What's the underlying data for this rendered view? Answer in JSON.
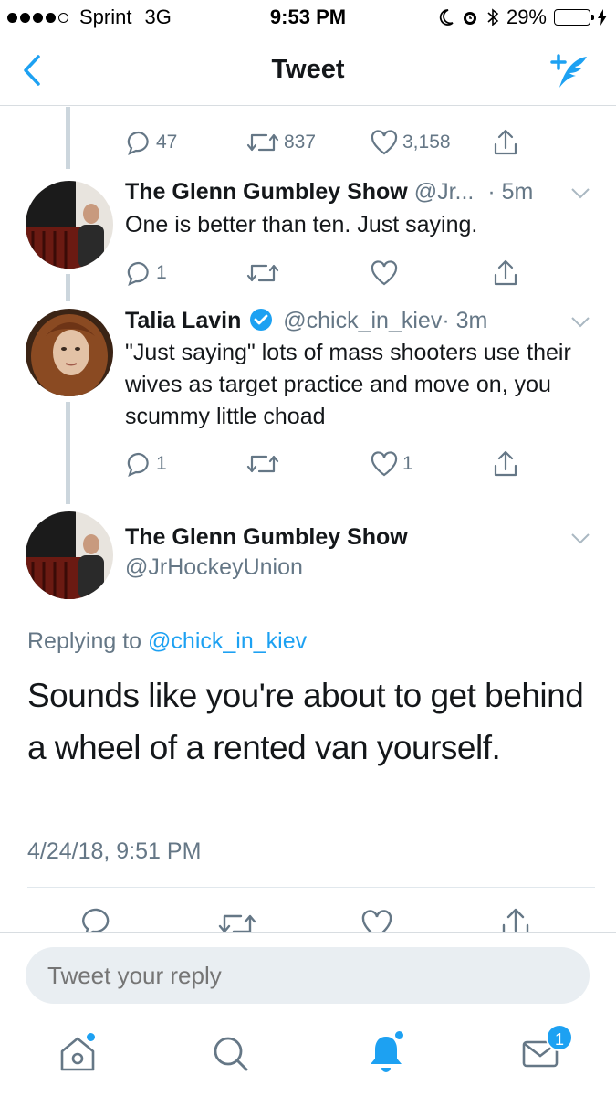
{
  "status_bar": {
    "carrier": "Sprint",
    "network": "3G",
    "time": "9:53 PM",
    "battery_percent": "29%",
    "battery_level": 0.29,
    "icons": [
      "moon-icon",
      "alarm-icon",
      "bluetooth-icon",
      "battery-icon",
      "charging-bolt-icon"
    ]
  },
  "nav": {
    "title": "Tweet",
    "back_icon": "chevron-left-icon",
    "compose_icon": "compose-tweet-icon"
  },
  "top_actions": {
    "reply_count": "47",
    "retweet_count": "837",
    "like_count": "3,158"
  },
  "tweets": [
    {
      "name": "The Glenn Gumbley Show",
      "handle": "@Jr...",
      "time": "· 5m",
      "text": "One is better than ten. Just saying.",
      "reply_count": "1",
      "retweet_count": "",
      "like_count": ""
    },
    {
      "name": "Talia Lavin",
      "verified": true,
      "handle": "@chick_in_kiev",
      "time": "· 3m",
      "text": "\"Just saying\" lots of mass shooters use their wives as target practice and move on, you scummy little choad",
      "reply_count": "1",
      "retweet_count": "",
      "like_count": "1"
    }
  ],
  "main_tweet": {
    "name": "The Glenn Gumbley Show",
    "handle": "@JrHockeyUnion",
    "replying_prefix": "Replying to",
    "replying_to": "@chick_in_kiev",
    "text": "Sounds like you're about to get behind a wheel of a rented van yourself.",
    "timestamp": "4/24/18, 9:51 PM"
  },
  "reply_bar": {
    "placeholder": "Tweet your reply"
  },
  "tabbar": {
    "items": [
      "home-icon",
      "search-icon",
      "notifications-icon",
      "messages-icon"
    ],
    "messages_badge": "1"
  },
  "colors": {
    "accent": "#1da1f2",
    "secondary_text": "#657786",
    "thread_line": "#ccd6dd"
  }
}
